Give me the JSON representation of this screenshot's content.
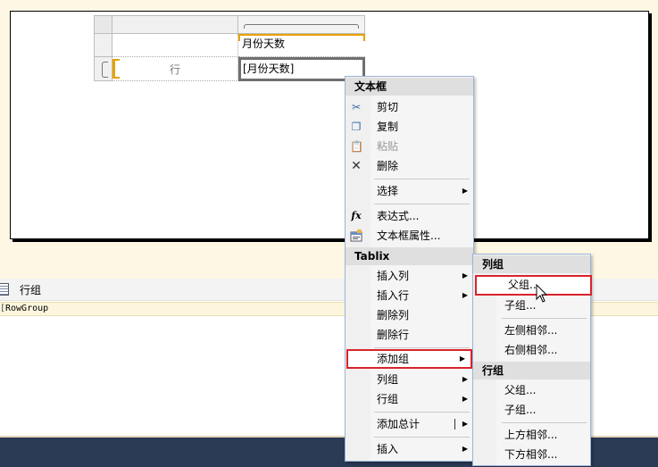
{
  "report_table": {
    "header_cell": "月份天数",
    "row_group_label": "行",
    "data_cell": "[月份天数]"
  },
  "grouping_pane": {
    "title": "行组",
    "row_group_name": "RowGroup"
  },
  "context_menu": {
    "textbox_header": "文本框",
    "cut": "剪切",
    "copy": "复制",
    "paste": "粘贴",
    "delete": "删除",
    "select": "选择",
    "expression": "表达式...",
    "textbox_properties": "文本框属性...",
    "tablix_header": "Tablix",
    "insert_column": "插入列",
    "insert_row": "插入行",
    "delete_column": "删除列",
    "delete_row": "删除行",
    "add_group": "添加组",
    "column_group": "列组",
    "row_group": "行组",
    "add_total": "添加总计",
    "insert": "插入"
  },
  "submenu": {
    "column_group_header": "列组",
    "parent_group": "父组...",
    "child_group": "子组...",
    "left_adjacent": "左侧相邻...",
    "right_adjacent": "右侧相邻...",
    "row_group_header": "行组",
    "row_parent_group": "父组...",
    "row_child_group": "子组...",
    "above_adjacent": "上方相邻...",
    "below_adjacent": "下方相邻..."
  },
  "icons": {
    "cut": "scissors-icon",
    "copy": "copy-icon",
    "paste": "paste-icon",
    "delete": "x-icon",
    "expression": "fx-icon",
    "properties": "properties-icon",
    "cursor": "mouse-pointer-icon"
  },
  "colors": {
    "highlight_border": "#d9232c",
    "selection_orange": "#e8a200",
    "status_bar": "#2b3a55"
  }
}
